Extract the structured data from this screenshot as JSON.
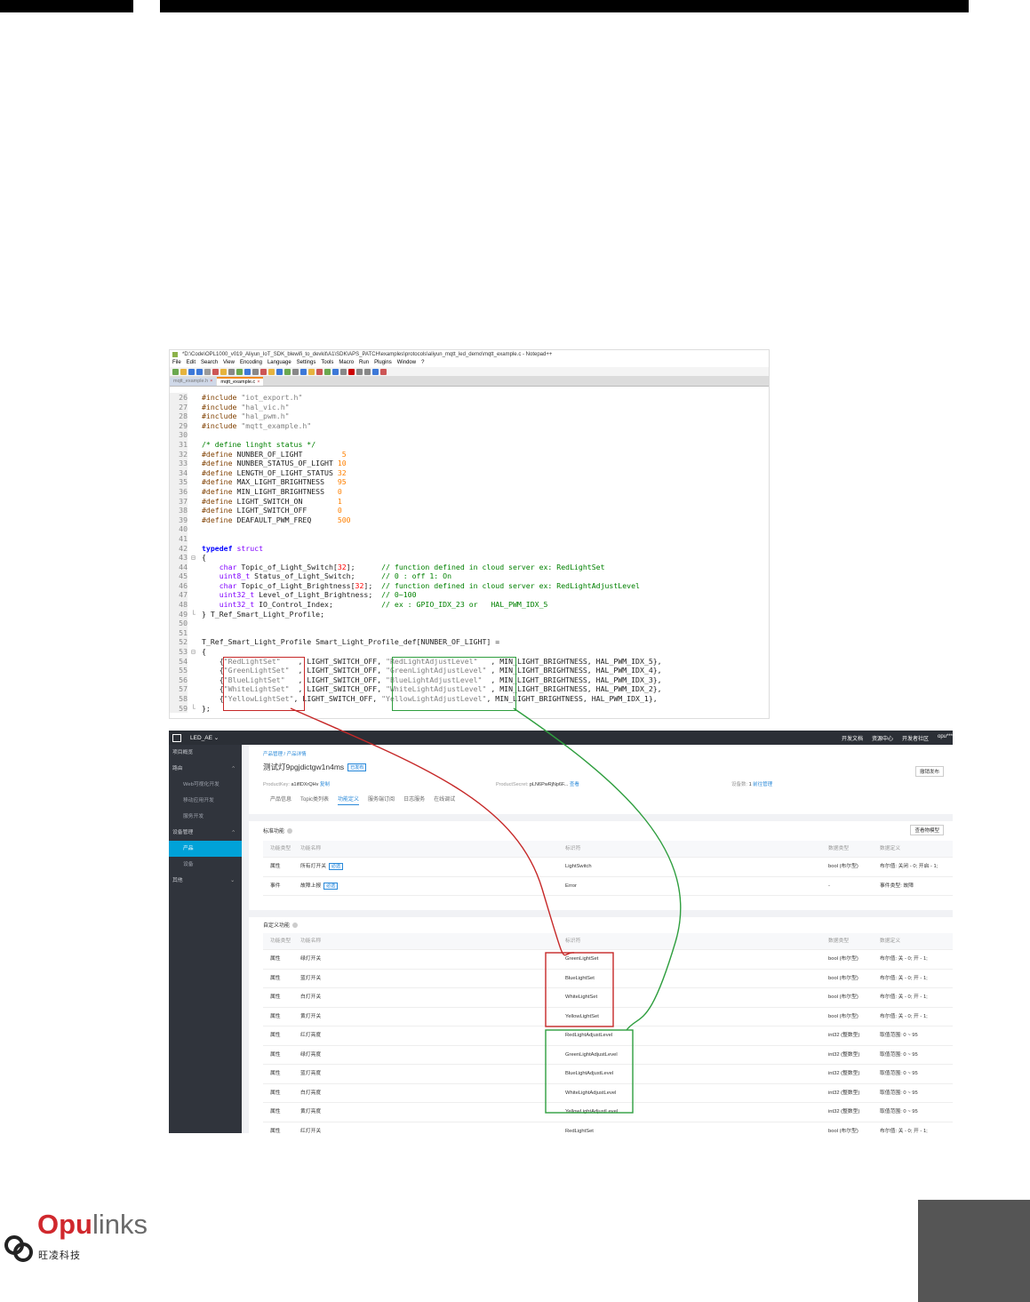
{
  "npp": {
    "title": "*D:\\Code\\OPL1000_v019_Aliyun_IoT_SDK_blewifi_to_devkit\\A1\\SDK\\APS_PATCH\\examples\\protocols\\aliyun_mqtt_led_demo\\mqtt_example.c - Notepad++",
    "menu": [
      "File",
      "Edit",
      "Search",
      "View",
      "Encoding",
      "Language",
      "Settings",
      "Tools",
      "Macro",
      "Run",
      "Plugins",
      "Window",
      "?"
    ],
    "tabs": [
      "mqtt_example.h",
      "mqtt_example.c"
    ],
    "lines": [
      {
        "n": "26",
        "t": "#include \"iot_export.h\""
      },
      {
        "n": "27",
        "t": "#include \"hal_vic.h\""
      },
      {
        "n": "28",
        "t": "#include \"hal_pwm.h\""
      },
      {
        "n": "29",
        "t": "#include \"mqtt_example.h\""
      },
      {
        "n": "30",
        "t": ""
      },
      {
        "n": "31",
        "t": "/* define linght status */"
      },
      {
        "n": "32",
        "t": "#define NUNBER_OF_LIGHT         5"
      },
      {
        "n": "33",
        "t": "#define NUNBER_STATUS_OF_LIGHT 10"
      },
      {
        "n": "34",
        "t": "#define LENGTH_OF_LIGHT_STATUS 32"
      },
      {
        "n": "35",
        "t": "#define MAX_LIGHT_BRIGHTNESS   95"
      },
      {
        "n": "36",
        "t": "#define MIN_LIGHT_BRIGHTNESS   0"
      },
      {
        "n": "37",
        "t": "#define LIGHT_SWITCH_ON        1"
      },
      {
        "n": "38",
        "t": "#define LIGHT_SWITCH_OFF       0"
      },
      {
        "n": "39",
        "t": "#define DEAFAULT_PWM_FREQ      500"
      },
      {
        "n": "40",
        "t": ""
      },
      {
        "n": "41",
        "t": ""
      },
      {
        "n": "42",
        "t": "typedef struct"
      },
      {
        "n": "43",
        "t": "{"
      },
      {
        "n": "44",
        "t": "    char Topic_of_Light_Switch[32];      // function defined in cloud server ex: RedLightSet"
      },
      {
        "n": "45",
        "t": "    uint8_t Status_of_Light_Switch;      // 0 : off 1: On"
      },
      {
        "n": "46",
        "t": "    char Topic_of_Light_Brightness[32];  // function defined in cloud server ex: RedLightAdjustLevel"
      },
      {
        "n": "47",
        "t": "    uint32_t Level_of_Light_Brightness;  // 0~100"
      },
      {
        "n": "48",
        "t": "    uint32_t IO_Control_Index;           // ex : GPIO_IDX_23 or   HAL_PWM_IDX_5"
      },
      {
        "n": "49",
        "t": "} T_Ref_Smart_Light_Profile;"
      },
      {
        "n": "50",
        "t": ""
      },
      {
        "n": "51",
        "t": ""
      },
      {
        "n": "52",
        "t": "T_Ref_Smart_Light_Profile Smart_Light_Profile_def[NUNBER_OF_LIGHT] ="
      },
      {
        "n": "53",
        "t": "{"
      },
      {
        "n": "54",
        "t": "    {\"RedLightSet\"    , LIGHT_SWITCH_OFF, \"RedLightAdjustLevel\"   , MIN_LIGHT_BRIGHTNESS, HAL_PWM_IDX_5},"
      },
      {
        "n": "55",
        "t": "    {\"GreenLightSet\"  , LIGHT_SWITCH_OFF, \"GreenLightAdjustLevel\" , MIN_LIGHT_BRIGHTNESS, HAL_PWM_IDX_4},"
      },
      {
        "n": "56",
        "t": "    {\"BlueLightSet\"   , LIGHT_SWITCH_OFF, \"BlueLightAdjustLevel\"  , MIN_LIGHT_BRIGHTNESS, HAL_PWM_IDX_3},"
      },
      {
        "n": "57",
        "t": "    {\"WhiteLightSet\"  , LIGHT_SWITCH_OFF, \"WhiteLightAdjustLevel\" , MIN_LIGHT_BRIGHTNESS, HAL_PWM_IDX_2},"
      },
      {
        "n": "58",
        "t": "    {\"YellowLightSet\", LIGHT_SWITCH_OFF, \"YellowLightAdjustLevel\", MIN_LIGHT_BRIGHTNESS, HAL_PWM_IDX_1},"
      },
      {
        "n": "59",
        "t": "};"
      }
    ]
  },
  "console": {
    "project": "LED_AE ⌄",
    "top_links": [
      "开发文档",
      "资源中心",
      "开发者社区",
      "opu***"
    ],
    "sidebar": [
      {
        "label": "项目概览",
        "type": "top"
      },
      {
        "label": "路由",
        "type": "top",
        "chev": "^"
      },
      {
        "label": "Web可视化开发",
        "type": "sub"
      },
      {
        "label": "移动应用开发",
        "type": "sub"
      },
      {
        "label": "服务开发",
        "type": "sub"
      },
      {
        "label": "设备管理",
        "type": "top",
        "chev": "^"
      },
      {
        "label": "产品",
        "type": "active"
      },
      {
        "label": "设备",
        "type": "sub"
      },
      {
        "label": "其他",
        "type": "top",
        "chev": "⌄"
      }
    ],
    "breadcrumb": "产品管理 / 产品详情",
    "product_title": "测试灯9pgjdictgw1n4ms",
    "product_badge": "已发布",
    "product_key_label": "ProductKey:",
    "product_key": "a1ifIDXrQHv",
    "copy": "复制",
    "product_secret_label": "ProductSecret:",
    "product_secret": "pLN6PwRjNp6F...",
    "show": "查看",
    "device_count_label": "设备数:",
    "device_count": "1",
    "goto_manage": "前往管理",
    "right_button": "撤销发布",
    "tabs": [
      "产品信息",
      "Topic类列表",
      "功能定义",
      "服务端订阅",
      "日志服务",
      "在线调试"
    ],
    "active_tab": "功能定义",
    "std_title": "标准功能",
    "model_button": "查看物模型",
    "columns": [
      "功能类型",
      "功能名称",
      "标识符",
      "数据类型",
      "数据定义"
    ],
    "std_rows": [
      {
        "type": "属性",
        "name": "所有灯开关",
        "req": "必选",
        "id": "LightSwitch",
        "dtype": "bool (布尔型)",
        "def": "布尔值: 关闭 - 0; 开启 - 1;"
      },
      {
        "type": "事件",
        "name": "故障上报",
        "req": "必选",
        "id": "Error",
        "dtype": "-",
        "def": "事件类型: 故障"
      }
    ],
    "custom_title": "自定义功能",
    "custom_rows": [
      {
        "type": "属性",
        "name": "绿灯开关",
        "id": "GreenLightSet",
        "dtype": "bool (布尔型)",
        "def": "布尔值: 关 - 0; 开 - 1;"
      },
      {
        "type": "属性",
        "name": "蓝灯开关",
        "id": "BlueLightSet",
        "dtype": "bool (布尔型)",
        "def": "布尔值: 关 - 0; 开 - 1;"
      },
      {
        "type": "属性",
        "name": "白灯开关",
        "id": "WhiteLightSet",
        "dtype": "bool (布尔型)",
        "def": "布尔值: 关 - 0; 开 - 1;"
      },
      {
        "type": "属性",
        "name": "黄灯开关",
        "id": "YellowLightSet",
        "dtype": "bool (布尔型)",
        "def": "布尔值: 关 - 0; 开 - 1;"
      },
      {
        "type": "属性",
        "name": "红灯亮度",
        "id": "RedLightAdjustLevel",
        "dtype": "int32 (整数型)",
        "def": "取值范围: 0 ~ 95"
      },
      {
        "type": "属性",
        "name": "绿灯亮度",
        "id": "GreenLightAdjustLevel",
        "dtype": "int32 (整数型)",
        "def": "取值范围: 0 ~ 95"
      },
      {
        "type": "属性",
        "name": "蓝灯亮度",
        "id": "BlueLightAdjustLevel",
        "dtype": "int32 (整数型)",
        "def": "取值范围: 0 ~ 95"
      },
      {
        "type": "属性",
        "name": "白灯亮度",
        "id": "WhiteLightAdjustLevel",
        "dtype": "int32 (整数型)",
        "def": "取值范围: 0 ~ 95"
      },
      {
        "type": "属性",
        "name": "黄灯亮度",
        "id": "YellowLightAdjustLevel",
        "dtype": "int32 (整数型)",
        "def": "取值范围: 0 ~ 95"
      },
      {
        "type": "属性",
        "name": "红灯开关",
        "id": "RedLightSet",
        "dtype": "bool (布尔型)",
        "def": "布尔值: 关 - 0; 开 - 1;"
      }
    ]
  },
  "logo": {
    "o": "O",
    "pu": "pu",
    "links": "links",
    "cn": "旺凌科技"
  },
  "colors": {
    "red_highlight": "#c62828",
    "green_highlight": "#2e9e3e",
    "console_accent": "#00a2d8",
    "brand_red": "#d0282d"
  }
}
